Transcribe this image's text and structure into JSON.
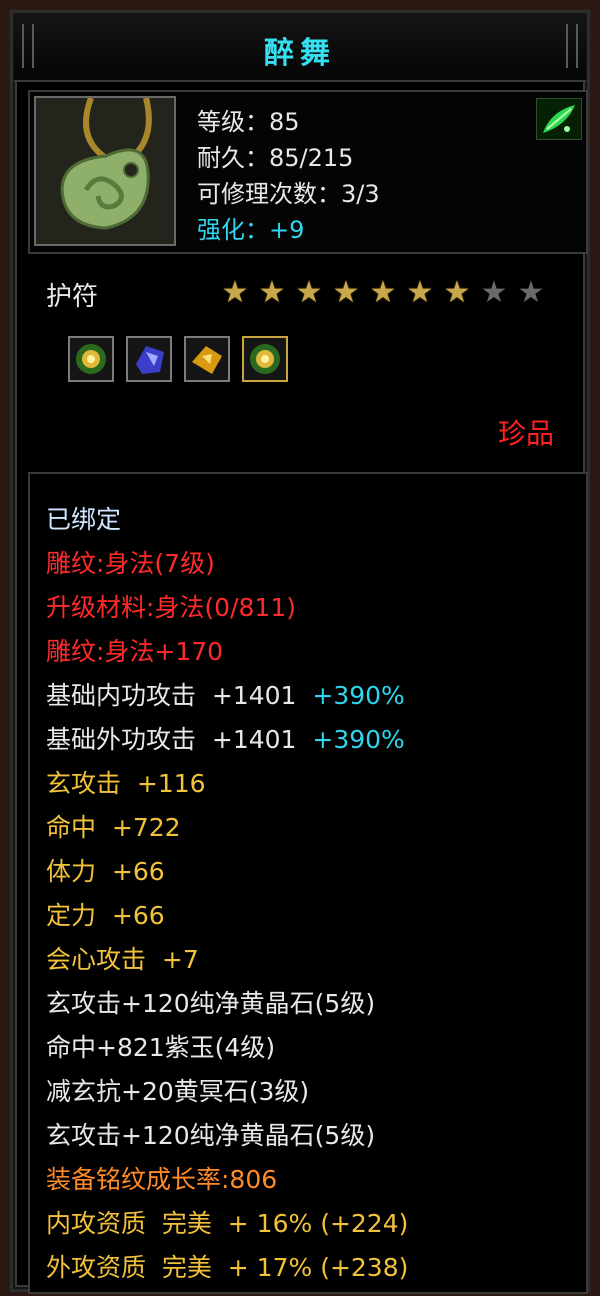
{
  "item": {
    "name": "醉舞",
    "type": "护符",
    "rarity": "珍品",
    "stars": {
      "filled": 7,
      "total": 9
    },
    "icon": "jade-pendant-icon",
    "corner_icon": "green-leaf-badge-icon"
  },
  "stats": {
    "level": "等级：85",
    "durability": "耐久：85/215",
    "repairs": "可修理次数：3/3",
    "enhance": "强化：+9"
  },
  "gem_slots": [
    "green-gold-orb-icon",
    "blue-crystal-icon",
    "yellow-crystal-icon",
    "green-gold-orb-icon"
  ],
  "details": {
    "bound": "已绑定",
    "engrave_level": "雕纹:身法(7级)",
    "upgrade_material": "升级材料:身法(0/811)",
    "engrave_bonus": "雕纹:身法+170",
    "inner_atk": {
      "label": "基础内功攻击  +1401",
      "pct": "+390%"
    },
    "outer_atk": {
      "label": "基础外功攻击  +1401",
      "pct": "+390%"
    },
    "xuan_atk": "玄攻击  +116",
    "hit": "命中  +722",
    "stamina": "体力  +66",
    "focus": "定力  +66",
    "crit": "会心攻击  +7",
    "gem1": "玄攻击+120纯净黄晶石(5级)",
    "gem2": "命中+821紫玉(4级)",
    "gem3": "减玄抗+20黄冥石(3级)",
    "gem4": "玄攻击+120纯净黄晶石(5级)",
    "growth": "装备铭纹成长率:806",
    "inner_quality": "内攻资质  完美  + 16% (+224)",
    "outer_quality": "外攻资质  完美  + 17% (+238)"
  },
  "colors": {
    "title": "#35e0f0",
    "enhance": "#2fd6ee",
    "engrave": "#ff2a2a",
    "attribute": "#f2c23a",
    "quality": "#ff8a28",
    "rarity": "#ff2020"
  }
}
